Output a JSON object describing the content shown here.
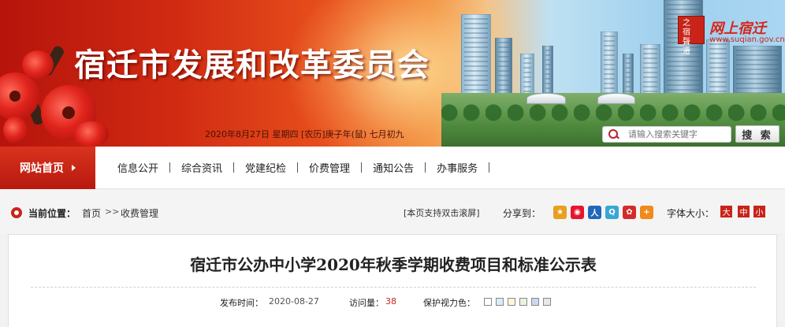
{
  "banner": {
    "title": "宿迁市发展和改革委员会",
    "seal_chars": [
      "之",
      "宿",
      "聲",
      "遷"
    ],
    "brand_text": "网上宿迁",
    "brand_url": "www.suqian.gov.cn",
    "date_line": "2020年8月27日  星期四  [农历]庚子年(鼠)  七月初九"
  },
  "search": {
    "placeholder": "请输入搜索关键字",
    "button_label": "搜 索"
  },
  "nav": {
    "home": "网站首页",
    "items": [
      "信息公开",
      "综合资讯",
      "党建纪检",
      "价费管理",
      "通知公告",
      "办事服务"
    ]
  },
  "breadcrumb": {
    "label": "当前位置：",
    "items": [
      "首页",
      "收费管理"
    ],
    "separator": ">>",
    "double_click_note": "[本页支持双击滚屏]",
    "share_label": "分享到：",
    "share_icons": [
      {
        "name": "qzone-icon",
        "glyph": "★",
        "color": "#e8a020"
      },
      {
        "name": "weibo-icon",
        "glyph": "◉",
        "color": "#e6162d"
      },
      {
        "name": "renren-icon",
        "glyph": "人",
        "color": "#2266bb"
      },
      {
        "name": "tencent-weibo-icon",
        "glyph": "Q",
        "color": "#3aa6d6"
      },
      {
        "name": "kaixin-icon",
        "glyph": "✿",
        "color": "#d42a2a"
      },
      {
        "name": "more-share-icon",
        "glyph": "+",
        "color": "#f08a1a"
      }
    ],
    "font_size_label": "字体大小：",
    "font_sizes": [
      "大",
      "中",
      "小"
    ]
  },
  "article": {
    "title": "宿迁市公办中小学2020年秋季学期收费项目和标准公示表",
    "publish_label": "发布时间：",
    "publish_date": "2020-08-27",
    "views_label": "访问量：",
    "views": "38",
    "eye_label": "保护视力色：",
    "eye_colors": [
      "#ffffff",
      "#d6eef8",
      "#fdf6d8",
      "#e9f3dc",
      "#c9d8f2",
      "#e8e8e8"
    ]
  },
  "colors": {
    "brand_red": "#c8241a",
    "nav_home_red": "#c8241a"
  }
}
